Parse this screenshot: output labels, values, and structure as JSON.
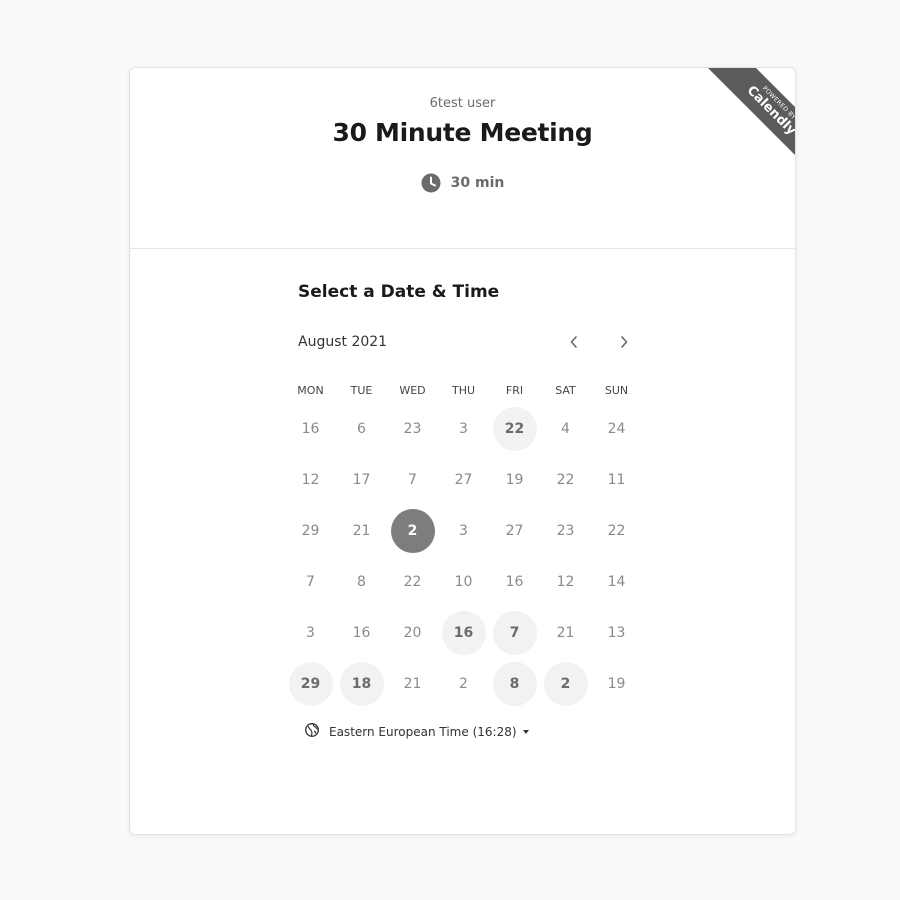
{
  "header": {
    "organizer": "6test user",
    "title": "30 Minute Meeting",
    "duration": "30 min",
    "duration_icon": "clock-icon"
  },
  "branding": {
    "powered_by": "POWERED BY",
    "brand": "Calendly"
  },
  "scheduler": {
    "section_title": "Select a Date & Time",
    "month": "August 2021",
    "prev_icon": "chevron-left-icon",
    "next_icon": "chevron-right-icon",
    "weekdays": [
      "MON",
      "TUE",
      "WED",
      "THU",
      "FRI",
      "SAT",
      "SUN"
    ],
    "weeks": [
      [
        {
          "d": "16"
        },
        {
          "d": "6"
        },
        {
          "d": "23"
        },
        {
          "d": "3"
        },
        {
          "d": "22",
          "state": "available"
        },
        {
          "d": "4"
        },
        {
          "d": "24"
        }
      ],
      [
        {
          "d": "12"
        },
        {
          "d": "17"
        },
        {
          "d": "7"
        },
        {
          "d": "27"
        },
        {
          "d": "19"
        },
        {
          "d": "22"
        },
        {
          "d": "11"
        }
      ],
      [
        {
          "d": "29"
        },
        {
          "d": "21"
        },
        {
          "d": "2",
          "state": "selected"
        },
        {
          "d": "3"
        },
        {
          "d": "27"
        },
        {
          "d": "23"
        },
        {
          "d": "22"
        }
      ],
      [
        {
          "d": "7"
        },
        {
          "d": "8"
        },
        {
          "d": "22"
        },
        {
          "d": "10"
        },
        {
          "d": "16"
        },
        {
          "d": "12"
        },
        {
          "d": "14"
        }
      ],
      [
        {
          "d": "3"
        },
        {
          "d": "16"
        },
        {
          "d": "20"
        },
        {
          "d": "16",
          "state": "available"
        },
        {
          "d": "7",
          "state": "available"
        },
        {
          "d": "21"
        },
        {
          "d": "13"
        }
      ],
      [
        {
          "d": "29",
          "state": "available"
        },
        {
          "d": "18",
          "state": "available"
        },
        {
          "d": "21"
        },
        {
          "d": "2"
        },
        {
          "d": "8",
          "state": "available"
        },
        {
          "d": "2",
          "state": "available"
        },
        {
          "d": "19"
        }
      ]
    ],
    "timezone": "Eastern European Time (16:28)",
    "timezone_icon": "globe-icon"
  },
  "colors": {
    "ribbon": "#5b5b5b",
    "selected_day": "#7d7d7d",
    "available_day": "#f2f2f2"
  }
}
